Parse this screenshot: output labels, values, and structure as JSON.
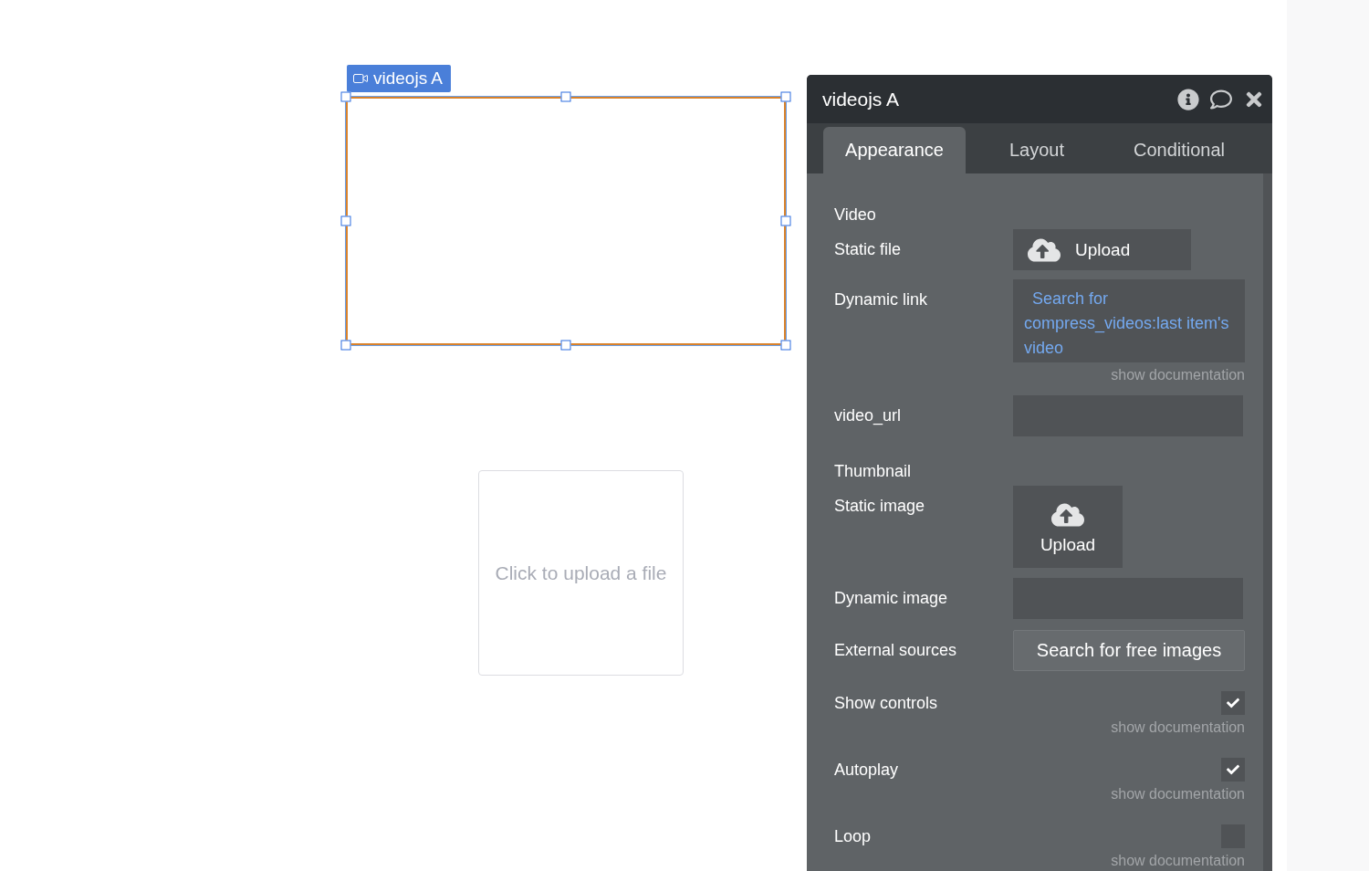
{
  "canvas": {
    "element_label": "videojs A",
    "upload_placeholder": "Click to upload a file"
  },
  "panel": {
    "title": "videojs A",
    "tabs": [
      {
        "label": "Appearance",
        "selected": true
      },
      {
        "label": "Layout",
        "selected": false
      },
      {
        "label": "Conditional",
        "selected": false
      }
    ],
    "rows": [
      {
        "kind": "heading",
        "label": "Video"
      },
      {
        "kind": "upload",
        "label": "Static file",
        "button": "Upload"
      },
      {
        "kind": "dynamic",
        "label": "Dynamic link",
        "value": "Search for compress_videos:last item's video",
        "doc": "show documentation"
      },
      {
        "kind": "input",
        "label": "video_url"
      },
      {
        "kind": "heading",
        "label": "Thumbnail"
      },
      {
        "kind": "upload_tile",
        "label": "Static image",
        "button": "Upload"
      },
      {
        "kind": "input",
        "label": "Dynamic image"
      },
      {
        "kind": "button",
        "label": "External sources",
        "button": "Search for free images"
      },
      {
        "kind": "checkbox",
        "label": "Show controls",
        "checked": true,
        "doc": "show documentation"
      },
      {
        "kind": "checkbox",
        "label": "Autoplay",
        "checked": true,
        "doc": "show documentation"
      },
      {
        "kind": "checkbox",
        "label": "Loop",
        "checked": false,
        "doc": "show documentation"
      }
    ]
  }
}
